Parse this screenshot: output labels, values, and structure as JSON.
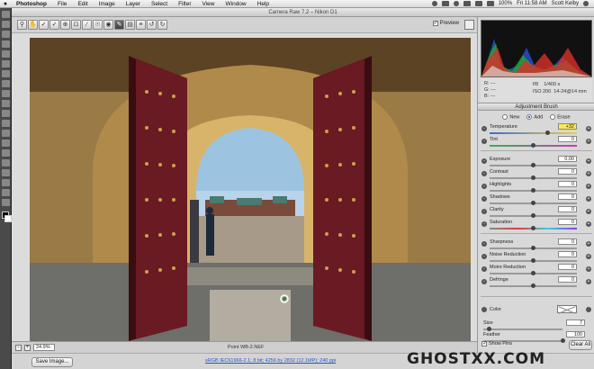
{
  "menubar": {
    "items": [
      "Photoshop",
      "File",
      "Edit",
      "Image",
      "Layer",
      "Select",
      "Filter",
      "View",
      "Window",
      "Help"
    ],
    "battery": "100%",
    "clock": "Fri 11:58 AM",
    "user": "Scott Kelby"
  },
  "window": {
    "title": "Camera Raw 7.2  –  Nikon D1"
  },
  "toolbar": {
    "preview_label": "Preview",
    "preview_checked": true
  },
  "statusbar": {
    "zoom": "24.9%",
    "filename": "Point WB-2.NEF"
  },
  "bottombar": {
    "save_label": "Save Image...",
    "workflow": "sRGB IEC61966-2.1; 8 bit; 4256 by 2832 (12.1MP); 240 ppi"
  },
  "info": {
    "r": "R:  ---",
    "g": "G:  ---",
    "b": "B:  ---",
    "aperture": "f/8",
    "shutter": "1/400 s",
    "iso": "ISO 200",
    "lens": "14-24@14 mm"
  },
  "panel": {
    "title": "Adjustment Brush",
    "modes": [
      "New",
      "Add",
      "Erase"
    ],
    "selected_mode": "Add",
    "sliders": [
      {
        "label": "Temperature",
        "value": "+32",
        "highlight": true,
        "level": 0.66,
        "track": "temp"
      },
      {
        "label": "Tint",
        "value": "0",
        "level": 0.5,
        "track": "tint"
      },
      {
        "label": "Exposure",
        "value": "0.00",
        "level": 0.5,
        "track": "gray"
      },
      {
        "label": "Contrast",
        "value": "0",
        "level": 0.5,
        "track": "gray"
      },
      {
        "label": "Highlights",
        "value": "0",
        "level": 0.5,
        "track": "gray"
      },
      {
        "label": "Shadows",
        "value": "0",
        "level": 0.5,
        "track": "gray"
      },
      {
        "label": "Clarity",
        "value": "0",
        "level": 0.5,
        "track": "gray"
      },
      {
        "label": "Saturation",
        "value": "0",
        "level": 0.5,
        "track": "sat"
      },
      {
        "label": "Sharpness",
        "value": "0",
        "level": 0.5,
        "track": "gray"
      },
      {
        "label": "Noise Reduction",
        "value": "0",
        "level": 0.5,
        "track": "gray"
      },
      {
        "label": "Moire Reduction",
        "value": "0",
        "level": 0.5,
        "track": "gray"
      },
      {
        "label": "Defringe",
        "value": "0",
        "level": 0.5,
        "track": "gray"
      }
    ],
    "color_label": "Color",
    "brush": [
      {
        "label": "Size",
        "value": "7",
        "level": 0.07
      },
      {
        "label": "Feather",
        "value": "100",
        "level": 1.0
      }
    ],
    "show_pins": "Show Pins",
    "clear_all": "Clear All"
  },
  "watermark": "GHOSTXX.COM"
}
